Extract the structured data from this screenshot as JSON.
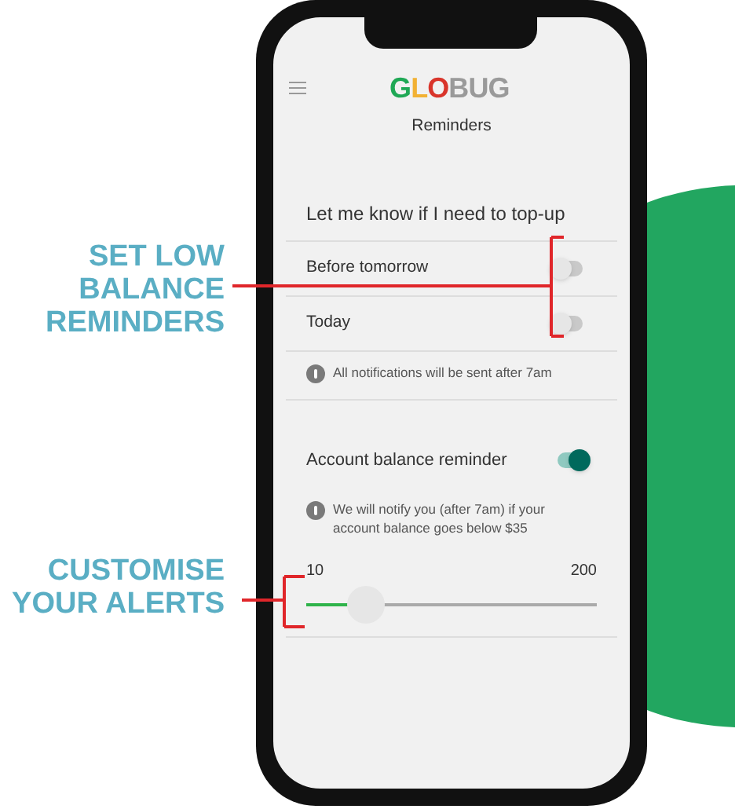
{
  "callouts": [
    {
      "lines": [
        "SET LOW",
        "BALANCE",
        "REMINDERS"
      ]
    },
    {
      "lines": [
        "CUSTOMISE",
        "YOUR ALERTS"
      ]
    }
  ],
  "app": {
    "logo": [
      {
        "text": "G",
        "color": "#1fa855"
      },
      {
        "text": "L",
        "color": "#f2b134"
      },
      {
        "text": "O",
        "color": "#d9352b"
      },
      {
        "text": "BUG",
        "color": "#9a9a9a"
      }
    ],
    "title": "Reminders",
    "section_heading": "Let me know if I need to top-up",
    "reminders": [
      {
        "label": "Before tomorrow",
        "on": false
      },
      {
        "label": "Today",
        "on": false
      }
    ],
    "reminders_note": "All notifications will be sent after 7am",
    "balance_reminder": {
      "label": "Account balance reminder",
      "on": true
    },
    "balance_note": "We will notify you (after 7am) if your account balance goes below $35",
    "slider": {
      "min": "10",
      "max": "200",
      "level": 0.15
    }
  }
}
